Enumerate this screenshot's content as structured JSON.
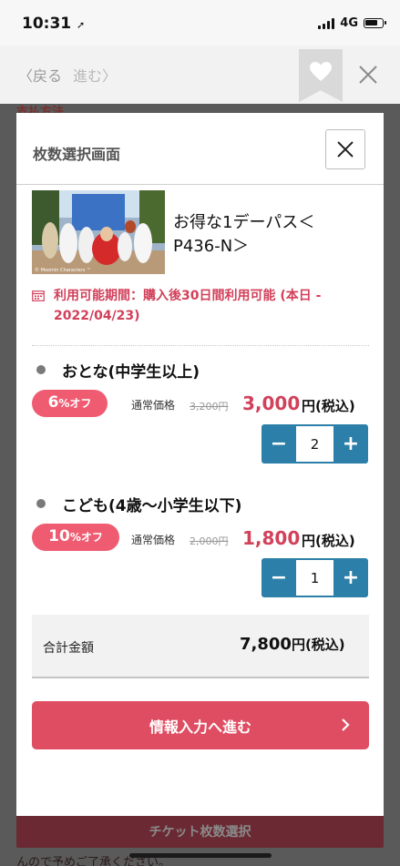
{
  "status_bar": {
    "time": "10:31",
    "network": "4G"
  },
  "browser": {
    "back_label": "戻る",
    "forward_label": "進む"
  },
  "background_page": {
    "section_text": "支払方法",
    "cta_label": "チケット枚数選択",
    "note_text": "んので予めご了承ください。"
  },
  "modal": {
    "title": "枚数選択画面",
    "product": {
      "name_line1": "お得な1デーパス＜",
      "name_line2": "P436-N＞",
      "image_caption": "© Moomin Characters ™"
    },
    "availability": {
      "line1": "利用可能期間：購入後30日間利用可能 (本日 -",
      "line2": "2022/04/23)"
    },
    "categories": [
      {
        "label": "おとな(中学生以上)",
        "discount_number": "6",
        "discount_unit": "%オフ",
        "regular_label": "通常価格",
        "regular_price": "3,200円",
        "sale_price": "3,000",
        "sale_suffix": "円(税込)",
        "quantity": "2"
      },
      {
        "label": "こども(4歳〜小学生以下)",
        "discount_number": "10",
        "discount_unit": "%オフ",
        "regular_label": "通常価格",
        "regular_price": "2,000円",
        "sale_price": "1,800",
        "sale_suffix": "円(税込)",
        "quantity": "1"
      }
    ],
    "stepper": {
      "minus": "−",
      "plus": "+"
    },
    "total": {
      "label": "合計金額",
      "value": "7,800",
      "suffix": "円(税込)"
    },
    "proceed_label": "情報入力へ進む"
  },
  "colors": {
    "accent": "#df4d63",
    "price": "#d2405a",
    "badge": "#ef5c72",
    "stepper": "#2c7fa8"
  }
}
